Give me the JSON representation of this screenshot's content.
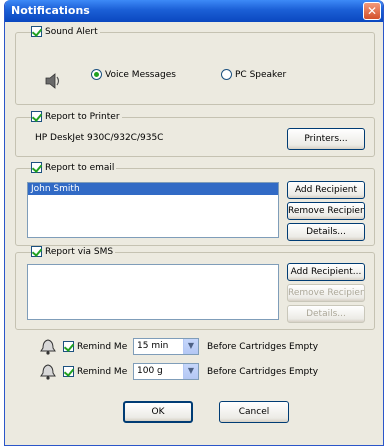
{
  "window": {
    "title": "Notifications",
    "close_glyph": "✕"
  },
  "sound_alert": {
    "label": "Sound Alert",
    "checked": true,
    "options": [
      {
        "label": "Voice Messages",
        "selected": true
      },
      {
        "label": "PC Speaker",
        "selected": false
      }
    ]
  },
  "printer": {
    "label": "Report to Printer",
    "checked": true,
    "name": "HP DeskJet 930C/932C/935C",
    "button": "Printers..."
  },
  "email": {
    "label": "Report to email",
    "checked": true,
    "recipients": [
      "John Smith"
    ],
    "buttons": {
      "add": "Add Recipient",
      "remove": "Remove Recipient",
      "details": "Details..."
    }
  },
  "sms": {
    "label": "Report via SMS",
    "checked": true,
    "recipients": [],
    "buttons": {
      "add": "Add Recipient...",
      "remove": "Remove Recipient",
      "details": "Details..."
    }
  },
  "reminders": [
    {
      "label": "Remind Me",
      "checked": true,
      "value": "15 min",
      "suffix": "Before Cartridges Empty",
      "icon": "bell-icon"
    },
    {
      "label": "Remind Me",
      "checked": true,
      "value": "100 g",
      "suffix": "Before Cartridges Empty",
      "icon": "bell-icon"
    }
  ],
  "footer": {
    "ok": "OK",
    "cancel": "Cancel"
  },
  "colors": {
    "titlebar": "#0a47bf",
    "dialog_bg": "#eceae0",
    "selection": "#316ac5",
    "check": "#21a121"
  }
}
